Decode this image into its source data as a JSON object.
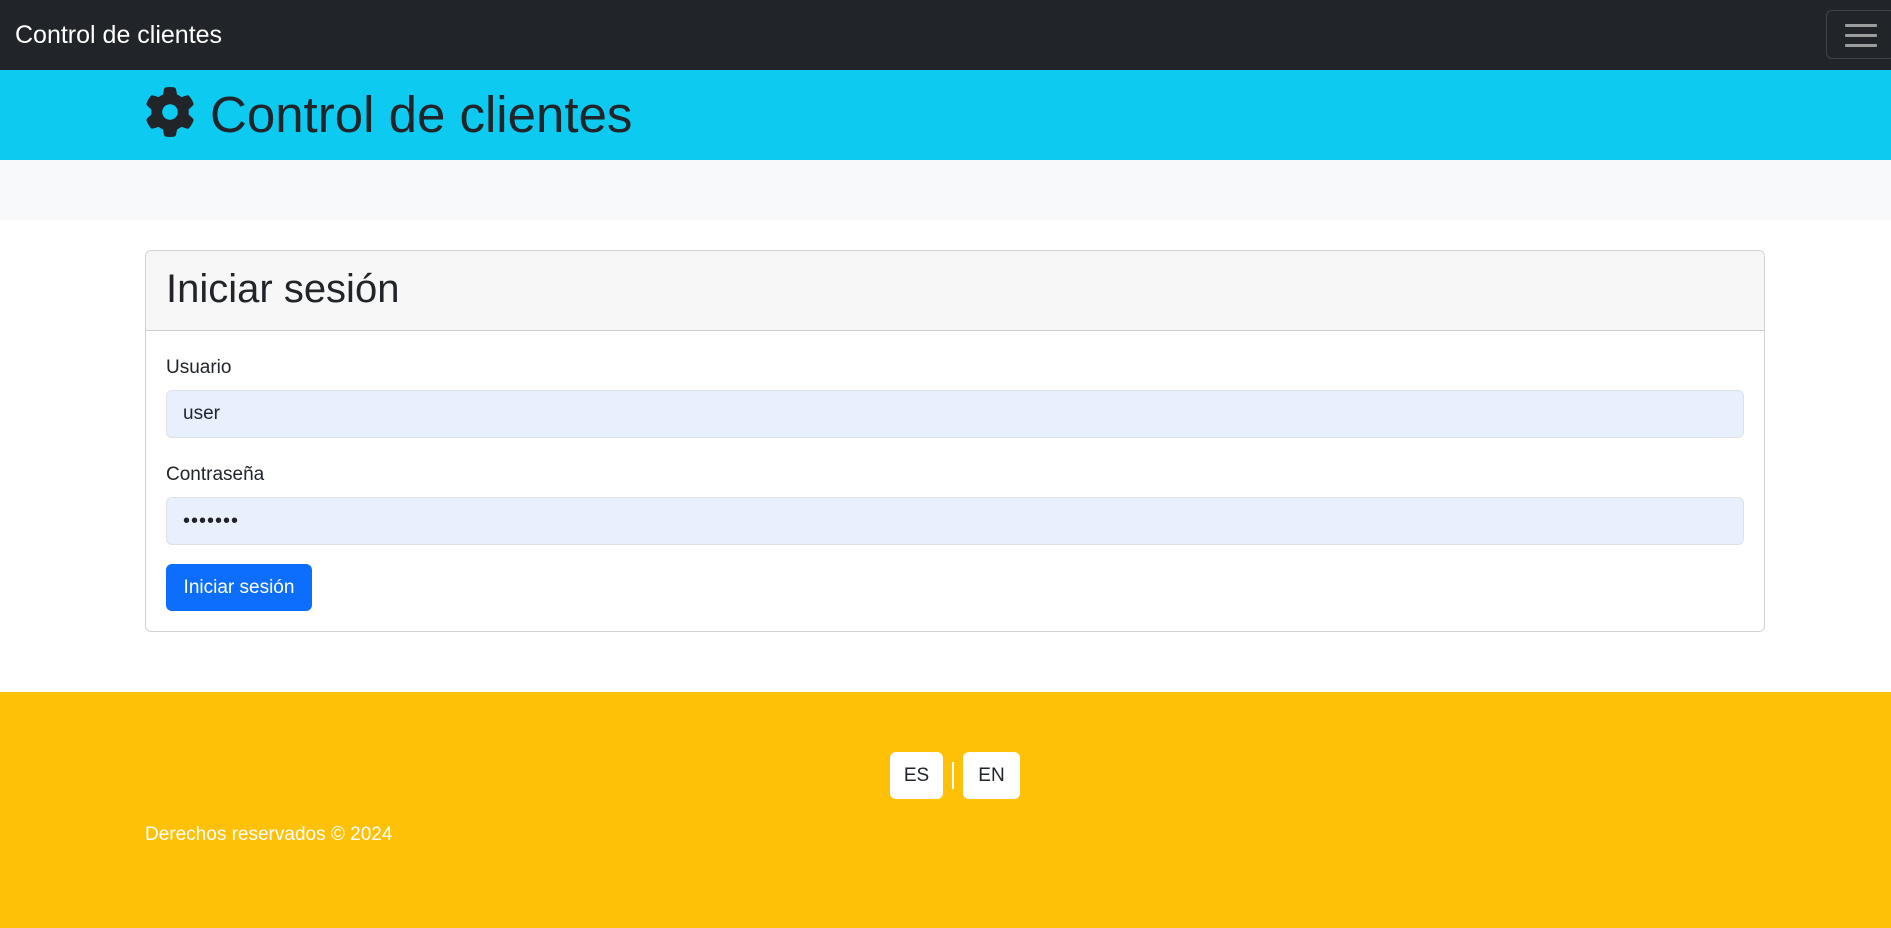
{
  "navbar": {
    "brand": "Control de clientes",
    "menu_icon": "hamburger-menu-icon"
  },
  "hero": {
    "icon": "gear-icon",
    "title": "Control de clientes"
  },
  "login": {
    "title": "Iniciar sesión",
    "username_label": "Usuario",
    "username_value": "user",
    "password_label": "Contraseña",
    "password_value": "•••••••",
    "submit_label": "Iniciar sesión"
  },
  "footer": {
    "lang_es": "ES",
    "lang_en": "EN",
    "copyright": "Derechos reservados © 2024"
  },
  "colors": {
    "navbar_bg": "#212529",
    "hero_bg": "#0dcaf0",
    "primary": "#0d6efd",
    "footer_bg": "#ffc107",
    "input_autofill_bg": "#e8f0fe"
  }
}
